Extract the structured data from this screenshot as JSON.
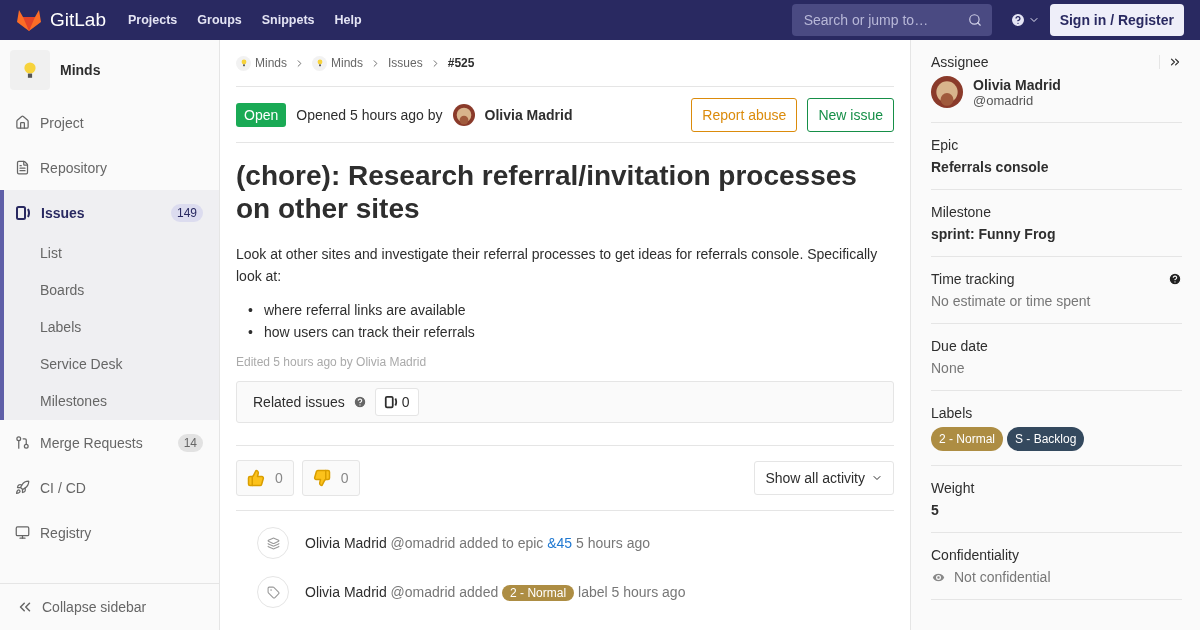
{
  "navbar": {
    "brand": "GitLab",
    "links": [
      "Projects",
      "Groups",
      "Snippets",
      "Help"
    ],
    "search": {
      "placeholder": "Search or jump to…"
    },
    "sign_in": "Sign in / Register"
  },
  "sidebar": {
    "project": "Minds",
    "items": [
      {
        "kind": "project",
        "label": "Project",
        "selected": false
      },
      {
        "kind": "repository",
        "label": "Repository",
        "selected": false
      },
      {
        "kind": "issues",
        "label": "Issues",
        "count": "149",
        "selected": true,
        "children": [
          {
            "label": "List"
          },
          {
            "label": "Boards"
          },
          {
            "label": "Labels"
          },
          {
            "label": "Service Desk"
          },
          {
            "label": "Milestones"
          }
        ]
      },
      {
        "kind": "merge",
        "label": "Merge Requests",
        "count": "14",
        "selected": false
      },
      {
        "kind": "cicd",
        "label": "CI / CD",
        "selected": false
      },
      {
        "kind": "registry",
        "label": "Registry",
        "selected": false
      }
    ],
    "collapse": "Collapse sidebar"
  },
  "breadcrumbs": [
    {
      "label": "Minds",
      "kind": "group"
    },
    {
      "label": "Minds",
      "kind": "project"
    },
    {
      "label": "Issues",
      "kind": "plain"
    },
    {
      "label": "#525",
      "kind": "current"
    }
  ],
  "issue": {
    "status": "Open",
    "opened": "Opened 5 hours ago by",
    "author": "Olivia Madrid",
    "actions": [
      {
        "label": "Report abuse",
        "kind": "warning"
      },
      {
        "label": "New issue",
        "kind": "success"
      }
    ],
    "title": "(chore): Research referral/invitation processes on other sites",
    "description": "Look at other sites and investigate their referral processes to get ideas for referrals console. Specifically look at:",
    "bullets": [
      {
        "marker": "•",
        "text": "where referral links are available"
      },
      {
        "marker": "•",
        "text": "how users can track their referrals"
      }
    ],
    "edited": "Edited 5 hours ago by Olivia Madrid",
    "related": {
      "label": "Related issues",
      "count": "0"
    },
    "reactions": [
      {
        "kind": "up",
        "count": "0"
      },
      {
        "kind": "down",
        "count": "0"
      }
    ],
    "activity_filter": "Show all activity",
    "activity": [
      {
        "kind": "epic",
        "author": "Olivia Madrid",
        "handle": "@omadrid",
        "action": "added to epic",
        "link": "&45",
        "time": "5 hours ago"
      },
      {
        "kind": "label",
        "author": "Olivia Madrid",
        "handle": "@omadrid",
        "action": "added",
        "label": "2 - Normal",
        "color": "#ad8d43",
        "after": "label",
        "time": "5 hours ago"
      }
    ]
  },
  "right_sidebar": {
    "assignee": {
      "title": "Assignee",
      "name": "Olivia Madrid",
      "handle": "@omadrid"
    },
    "sections": [
      {
        "kind": "bold",
        "title": "Epic",
        "value": "Referrals console"
      },
      {
        "kind": "bold",
        "title": "Milestone",
        "value": "sprint: Funny Frog"
      },
      {
        "kind": "muted",
        "title": "Time tracking",
        "value": "No estimate or time spent",
        "help": true
      },
      {
        "kind": "muted",
        "title": "Due date",
        "value": "None"
      },
      {
        "kind": "labels",
        "title": "Labels",
        "labels": [
          {
            "label": "2 - Normal",
            "color": "#ad8d43"
          },
          {
            "label": "S - Backlog",
            "color": "#34495e"
          }
        ]
      },
      {
        "kind": "bold",
        "title": "Weight",
        "value": "5"
      },
      {
        "kind": "eye",
        "title": "Confidentiality",
        "value": "Not confidential"
      }
    ]
  }
}
